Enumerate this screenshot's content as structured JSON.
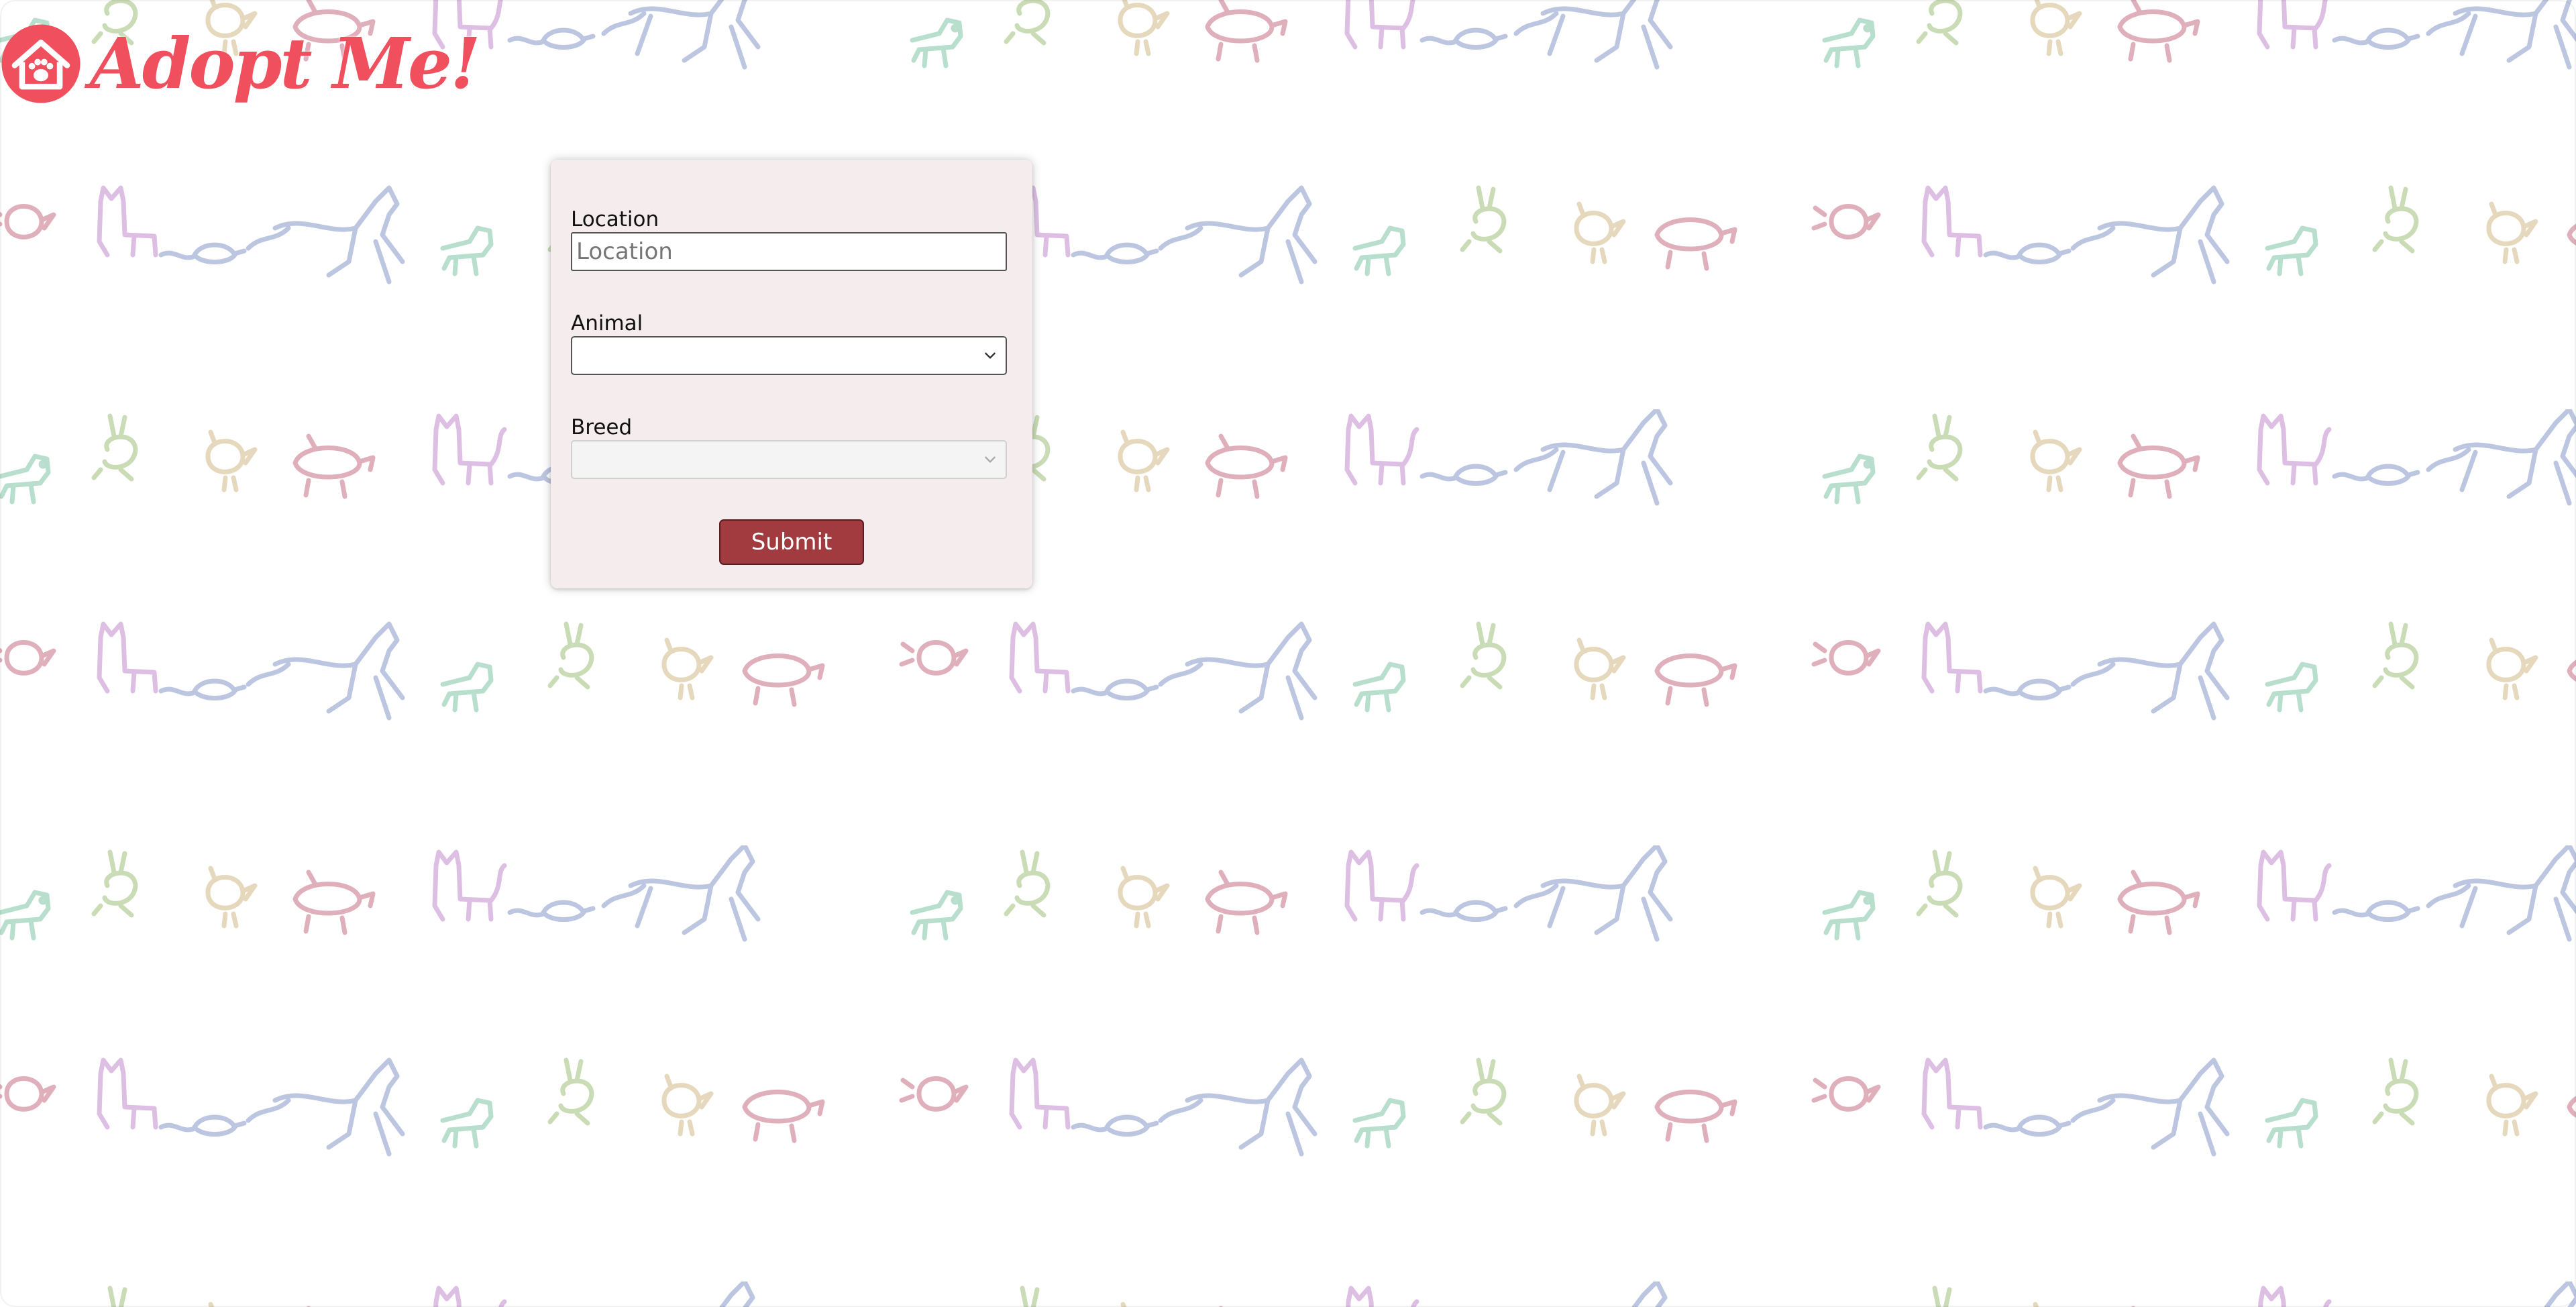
{
  "app": {
    "logo_text": "Adopt Me!"
  },
  "search_form": {
    "location_label": "Location",
    "location_placeholder": "Location",
    "location_value": "",
    "animal_label": "Animal",
    "animal_selected": "",
    "breed_label": "Breed",
    "breed_selected": "",
    "breed_disabled": true,
    "submit_label": "Submit"
  },
  "icons": {
    "logo": "house-with-paw-icon",
    "select_arrow": "chevron-down-icon",
    "background": "animal-doodle-pattern"
  },
  "colors": {
    "brand": "#f0505d",
    "card_background": "#f5eded",
    "submit_background": "#a23b3f",
    "submit_border": "#5a1d20",
    "doodle_colors": [
      "#7fc4a6",
      "#9fc07a",
      "#d0ba88",
      "#c86e86",
      "#c28cce",
      "#8798c8"
    ]
  }
}
